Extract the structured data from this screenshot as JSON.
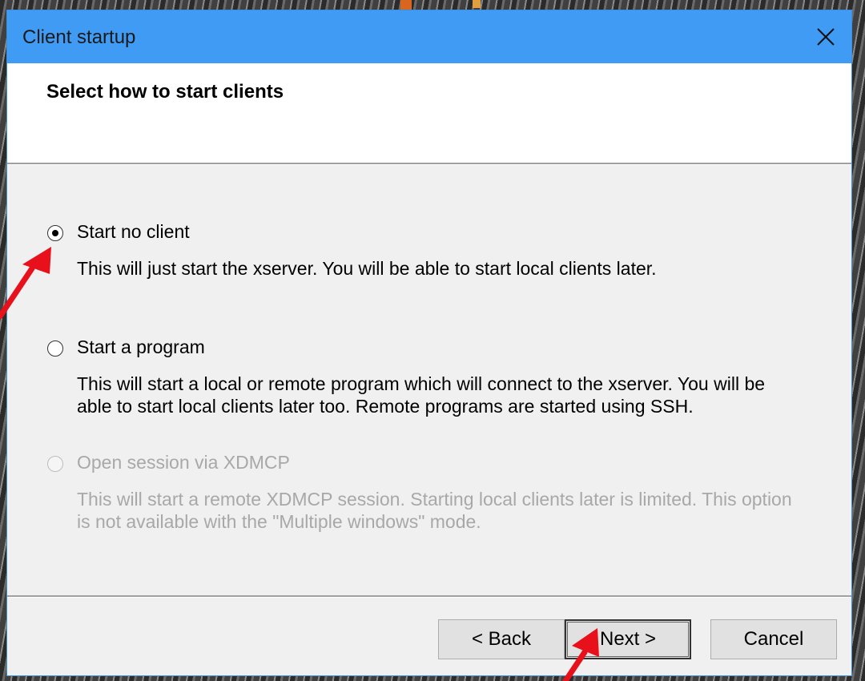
{
  "window": {
    "title": "Client startup"
  },
  "header": {
    "title": "Select how to start clients"
  },
  "options": [
    {
      "label": "Start no client",
      "description": "This will just start the xserver. You will be able to start local clients later.",
      "selected": true,
      "enabled": true
    },
    {
      "label": "Start a program",
      "description": "This will start a local or remote program which will connect to the xserver. You will be able to start local clients later too. Remote programs are started using SSH.",
      "selected": false,
      "enabled": true
    },
    {
      "label": "Open session via XDMCP",
      "description": "This will start a remote XDMCP session. Starting local clients later is limited. This option is not available with the \"Multiple windows\" mode.",
      "selected": false,
      "enabled": false
    }
  ],
  "buttons": {
    "back": "< Back",
    "next": "Next >",
    "cancel": "Cancel"
  },
  "colors": {
    "titlebar": "#3f9bf4",
    "annotation_arrow": "#e8101a"
  }
}
